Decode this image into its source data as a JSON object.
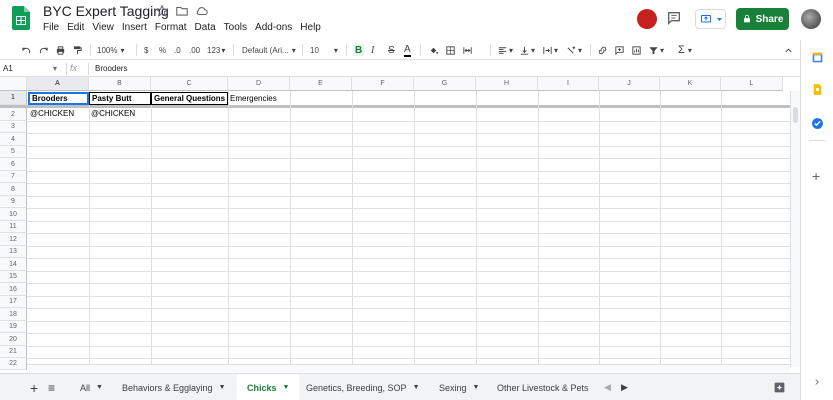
{
  "title": {
    "doc_title": "BYC Expert Tagging",
    "menu": [
      "File",
      "Edit",
      "View",
      "Insert",
      "Format",
      "Data",
      "Tools",
      "Add-ons",
      "Help"
    ],
    "share_label": "Share"
  },
  "toolbar": {
    "zoom": "100%",
    "currency": "$",
    "percent": "%",
    "dec_less": ".0",
    "dec_more": ".00",
    "format_more": "123",
    "font": "Default (Ari...",
    "font_size": "10",
    "bold": "B",
    "italic": "I",
    "strike": "S",
    "text_color": "A"
  },
  "formula_bar": {
    "name_box": "A1",
    "fx": "fx",
    "value": "Brooders"
  },
  "columns": [
    "A",
    "B",
    "C",
    "D",
    "E",
    "F",
    "G",
    "H",
    "I",
    "J",
    "K",
    "L"
  ],
  "rows": [
    "1",
    "2",
    "3",
    "4",
    "5",
    "6",
    "7",
    "8",
    "9",
    "10",
    "11",
    "12",
    "13",
    "14",
    "15",
    "16",
    "17",
    "18",
    "19",
    "20",
    "21",
    "22"
  ],
  "cells": {
    "A1": "Brooders",
    "B1": "Pasty Butt",
    "C1": "General Questions",
    "D1": "Emergencies",
    "A2": "@CHICKEN",
    "B2": "@CHICKEN"
  },
  "tabs": [
    "All",
    "Behaviors & Egglaying",
    "Chicks",
    "Genetics, Breeding, SOP",
    "Sexing",
    "Other Livestock & Pets"
  ],
  "active_tab": "Chicks",
  "colors": {
    "share_green": "#188038",
    "active_tab_text": "#188038",
    "selection_blue": "#1a73e8"
  }
}
